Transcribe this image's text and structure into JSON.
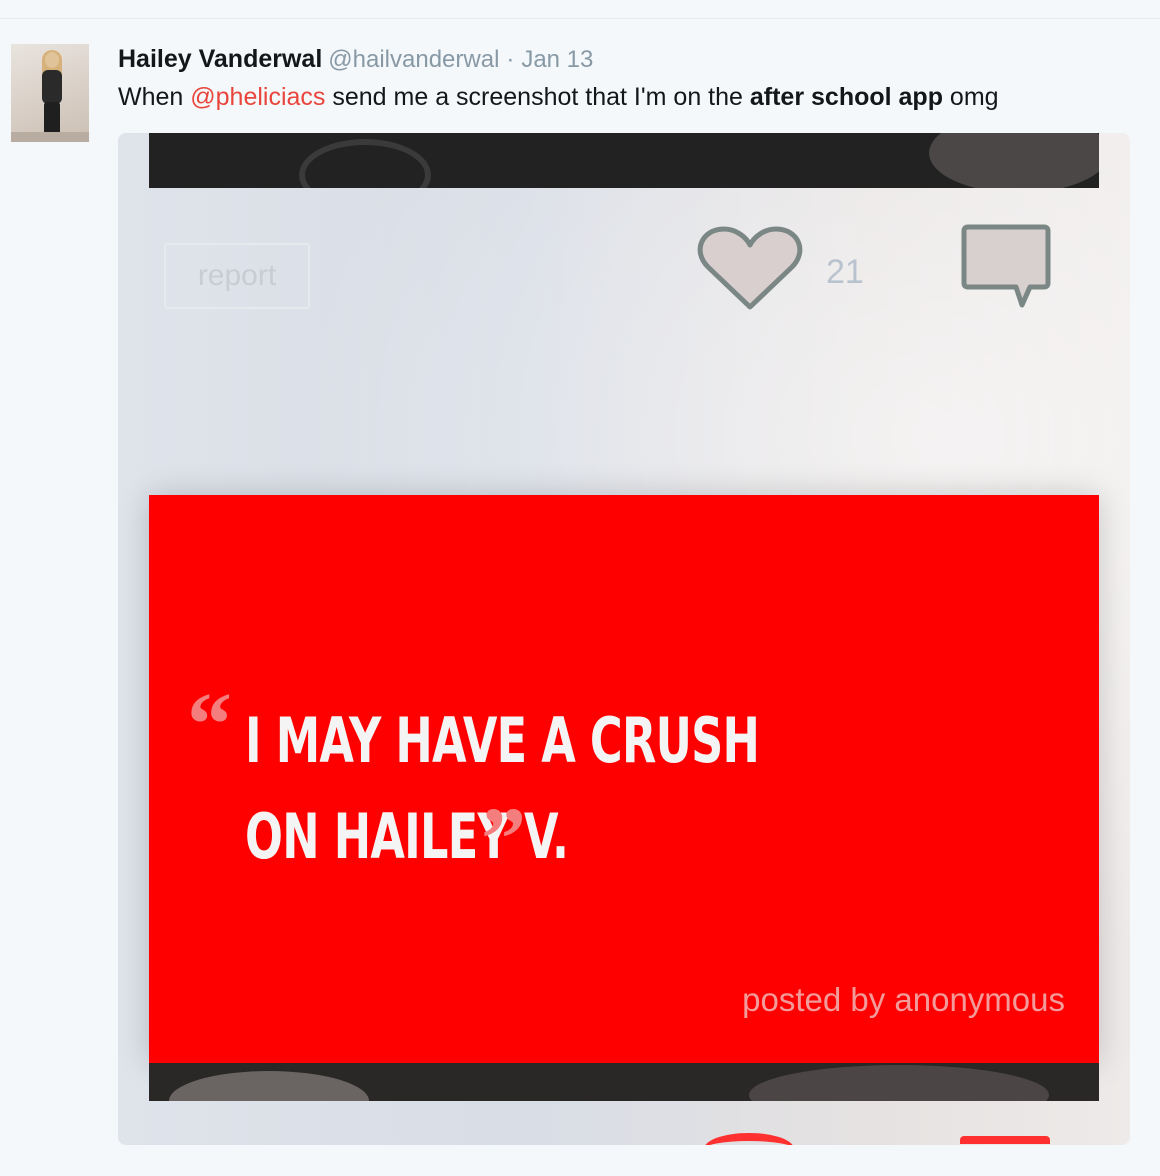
{
  "tweet": {
    "author_name": "Hailey Vanderwal",
    "author_handle": "@hailvanderwal",
    "separator": "·",
    "date": "Jan 13",
    "text_before": "When ",
    "mention": "@pheliciacs",
    "text_middle": " send me a screenshot that I'm on the ",
    "text_bold": "after school app",
    "text_after": " omg"
  },
  "media": {
    "report_label": "report",
    "like_count": "21",
    "quote_open": "“",
    "quote_text": "I MAY HAVE A CRUSH ON HAILEY V.",
    "quote_close": "”",
    "posted_by": "posted by anonymous"
  },
  "colors": {
    "card_red": "#ff0000",
    "mention": "#e8453c",
    "muted": "#8899a6"
  },
  "icons": [
    "heart-icon",
    "comment-icon"
  ]
}
